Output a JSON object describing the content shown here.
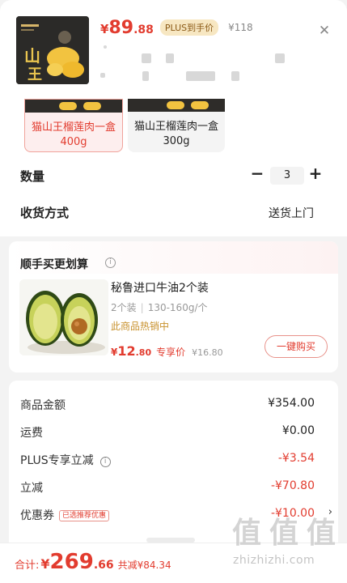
{
  "header": {
    "price_symbol": "¥",
    "price_int": "89",
    "price_dec": ".88",
    "plus_tag": "PLUS到手价",
    "original_price": "¥118",
    "close_icon": "close-icon"
  },
  "specs": [
    {
      "line1": "猫山王榴莲肉一盒",
      "line2": "400g",
      "selected": true
    },
    {
      "line1": "猫山王榴莲肉一盒",
      "line2": "300g",
      "selected": false
    }
  ],
  "quantity": {
    "label": "数量",
    "minus": "−",
    "value": "3",
    "plus": "+"
  },
  "shipping": {
    "label": "收货方式",
    "value": "送货上门"
  },
  "recommend": {
    "title": "顺手买更划算",
    "info_icon": "i",
    "name": "秘鲁进口牛油2个装",
    "spec_count": "2个装",
    "spec_weight": "130-160g/个",
    "hot": "此商品热销中",
    "price_symbol": "¥",
    "price_int": "12",
    "price_dec": ".80",
    "price_tag": "专享价",
    "original_price": "¥16.80",
    "buy_label": "一键购买"
  },
  "summary": {
    "rows": [
      {
        "label": "商品金额",
        "value": "¥354.00"
      },
      {
        "label": "运费",
        "value": "¥0.00"
      },
      {
        "label": "PLUS专享立减",
        "value": "-¥3.54"
      },
      {
        "label": "立减",
        "value": "-¥70.80"
      },
      {
        "label": "优惠券",
        "value": "-¥10.00"
      }
    ],
    "coupon_tag": "已选推荐优惠",
    "tip_icon": "i",
    "chevron": "›"
  },
  "bottom": {
    "total_label": "合计:",
    "total_symbol": "¥",
    "total_int": "269",
    "total_dec": ".66",
    "saved": "共减¥84.34"
  },
  "watermark": {
    "logo": "值值值",
    "text": "zhizhizhi.com"
  },
  "colors": {
    "accent_red": "#e23c2f",
    "plus_gold": "#f7e7c2",
    "hot_gold": "#c8912c"
  }
}
